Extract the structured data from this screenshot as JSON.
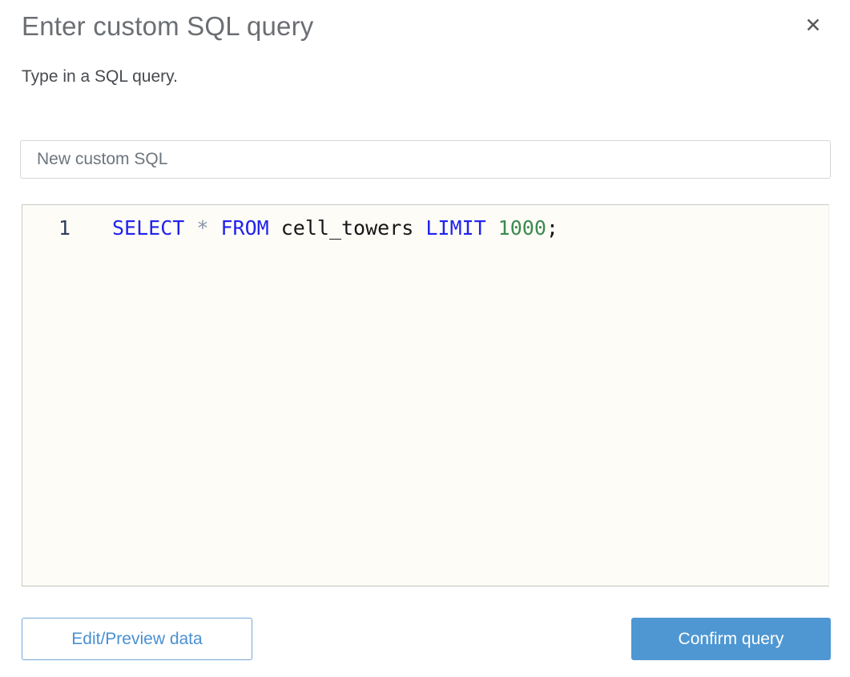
{
  "dialog": {
    "title": "Enter custom SQL query",
    "subtitle": "Type in a SQL query.",
    "close_icon": "✕"
  },
  "name_input": {
    "value": "New custom SQL"
  },
  "editor": {
    "line_number": "1",
    "sql_text": "SELECT * FROM cell_towers LIMIT 1000;",
    "tokens": [
      {
        "text": "SELECT ",
        "type": "keyword"
      },
      {
        "text": "* ",
        "type": "operator"
      },
      {
        "text": "FROM ",
        "type": "keyword"
      },
      {
        "text": "cell_towers ",
        "type": "identifier"
      },
      {
        "text": "LIMIT ",
        "type": "keyword"
      },
      {
        "text": "1000",
        "type": "number"
      },
      {
        "text": ";",
        "type": "punctuation"
      }
    ]
  },
  "buttons": {
    "edit_preview": "Edit/Preview data",
    "confirm": "Confirm query"
  },
  "colors": {
    "accent_blue": "#4e97d3",
    "outline_button_blue": "#4a90d2",
    "keyword_blue": "#2222ee",
    "number_green": "#3c8a50",
    "line_number_navy": "#2c3e5f",
    "editor_background": "#fdfcf6",
    "title_gray": "#6b6e72"
  }
}
